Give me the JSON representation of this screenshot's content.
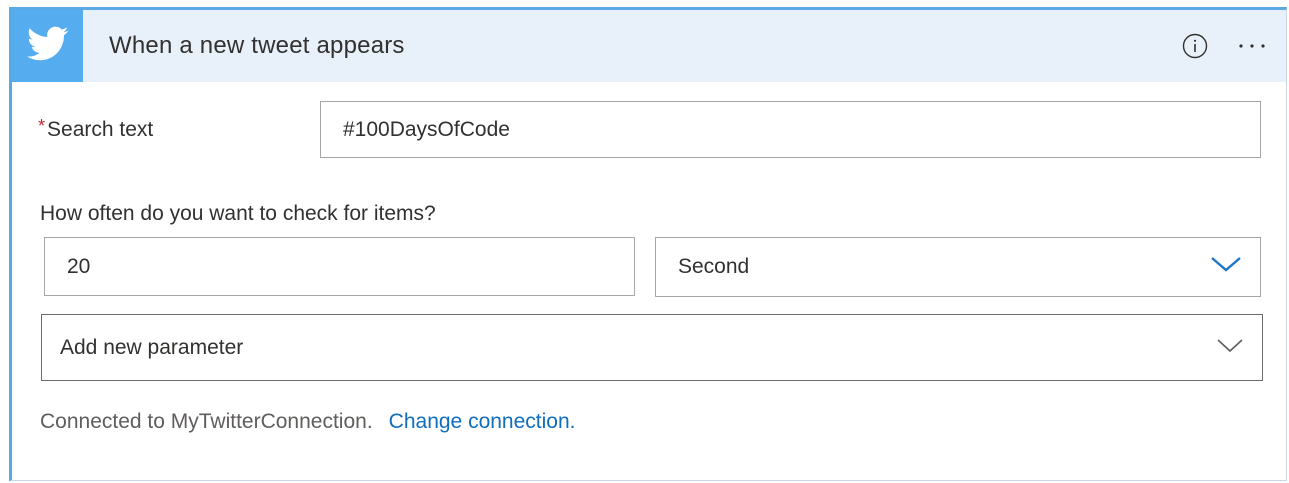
{
  "trigger": {
    "title": "When a new tweet appears",
    "icons": {
      "brand": "twitter-bird-icon",
      "info": "info-icon",
      "more": "more-options-icon"
    },
    "brand_color": "#55acee",
    "header_bg": "#e8f1fa"
  },
  "search": {
    "required_mark": "*",
    "label": "Search text",
    "value": "#100DaysOfCode"
  },
  "frequency": {
    "question": "How often do you want to check for items?",
    "interval_value": "20",
    "unit_value": "Second"
  },
  "parameters": {
    "placeholder": "Add new parameter"
  },
  "connection": {
    "status": "Connected to MyTwitterConnection.",
    "change_label": "Change connection."
  },
  "colors": {
    "accent": "#59a9e4",
    "link": "#106ebe",
    "required": "#c4262e"
  }
}
